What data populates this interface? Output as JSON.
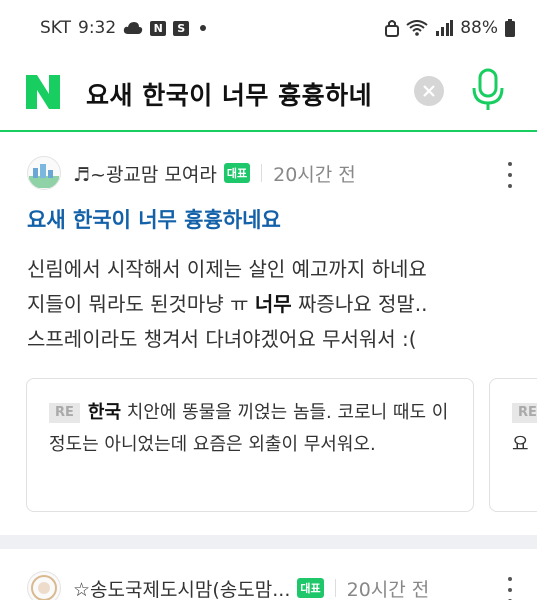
{
  "status_bar": {
    "carrier": "SKT",
    "time": "9:32",
    "notif_n": "N",
    "notif_s": "S",
    "battery": "88%"
  },
  "search": {
    "logo": "N",
    "query": "요새 한국이 너무 흉흉하네"
  },
  "posts": [
    {
      "cafe_name": "♬~광교맘 모여라",
      "badge": "대표",
      "time": "20시간 전",
      "title": "요새 한국이 너무 흉흉하네요",
      "body_line1": "신림에서 시작해서 이제는 살인 예고까지 하네요",
      "body_line2_pre": "지들이 뭐라도 된것마냥 ㅠ ",
      "body_line2_bold": "너무",
      "body_line2_post": " 짜증나요 정말..",
      "body_line3": "스프레이라도 챙겨서 다녀야겠어요 무서워서 :(",
      "replies": [
        {
          "badge": "RE",
          "bold": "한국",
          "text": " 치안에 똥물을 끼얹는 놈들. 코로니 때도 이 정도는 아니었는데 요즘은 외출이 무서워오."
        },
        {
          "badge": "RE",
          "bold": "",
          "text": "요"
        }
      ]
    },
    {
      "cafe_name": "☆송도국제도시맘(송도맘...",
      "badge": "대표",
      "time": "20시간 전"
    }
  ],
  "colors": {
    "naver_green": "#19ce60",
    "title_blue": "#1361a8",
    "badge_green": "#1ec76a"
  },
  "icons": [
    "cloud-icon",
    "wifi-icon",
    "signal-icon",
    "battery-icon",
    "clear-icon",
    "mic-icon",
    "more-icon"
  ]
}
